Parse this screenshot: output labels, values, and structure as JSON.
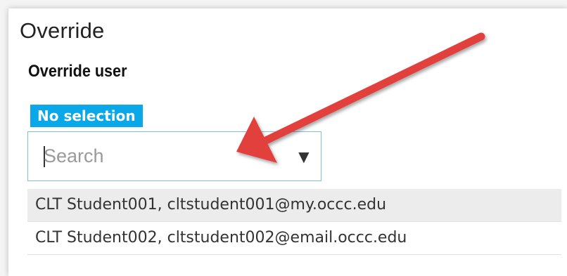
{
  "panel": {
    "title": "Override"
  },
  "override_user": {
    "label": "Override user",
    "selection_badge": "No selection",
    "search": {
      "value": "",
      "placeholder": "Search",
      "dropdown_icon": "▼"
    },
    "options": [
      {
        "text": "CLT Student001, cltstudent001@my.occc.edu",
        "highlighted": true
      },
      {
        "text": "CLT Student002, cltstudent002@email.occc.edu",
        "highlighted": false
      }
    ]
  },
  "annotation": {
    "arrow_color": "#e2403c",
    "icon": "annotation-arrow-icon"
  },
  "colors": {
    "badge_background": "#0aa8e8",
    "input_border": "#7cc0e4",
    "highlighted_row": "#ececec"
  }
}
